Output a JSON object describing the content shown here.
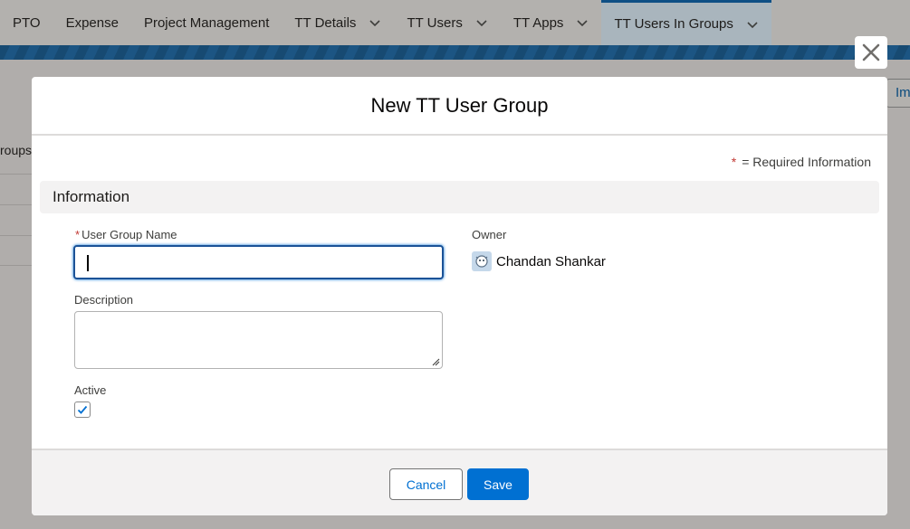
{
  "nav": {
    "items": [
      {
        "label": "PTO",
        "has_menu": false
      },
      {
        "label": "Expense",
        "has_menu": false
      },
      {
        "label": "Project Management",
        "has_menu": false
      },
      {
        "label": "TT Details",
        "has_menu": true
      },
      {
        "label": "TT Users",
        "has_menu": true
      },
      {
        "label": "TT Apps",
        "has_menu": true
      },
      {
        "label": "TT Users In Groups",
        "has_menu": true,
        "active": true
      }
    ]
  },
  "background": {
    "list_fragment": "roups",
    "button_fragment": "Im"
  },
  "modal": {
    "title": "New TT User Group",
    "required_marker": "*",
    "required_text": "= Required Information",
    "section_title": "Information",
    "fields": {
      "user_group_name": {
        "label": "User Group Name",
        "required_marker": "*",
        "value": ""
      },
      "description": {
        "label": "Description",
        "value": ""
      },
      "active": {
        "label": "Active",
        "checked": true
      },
      "owner": {
        "label": "Owner",
        "value": "Chandan Shankar",
        "icon": "user-avatar-icon"
      }
    },
    "footer": {
      "cancel_label": "Cancel",
      "save_label": "Save"
    }
  },
  "colors": {
    "brand_blue": "#0070d2",
    "required_red": "#c23934"
  }
}
